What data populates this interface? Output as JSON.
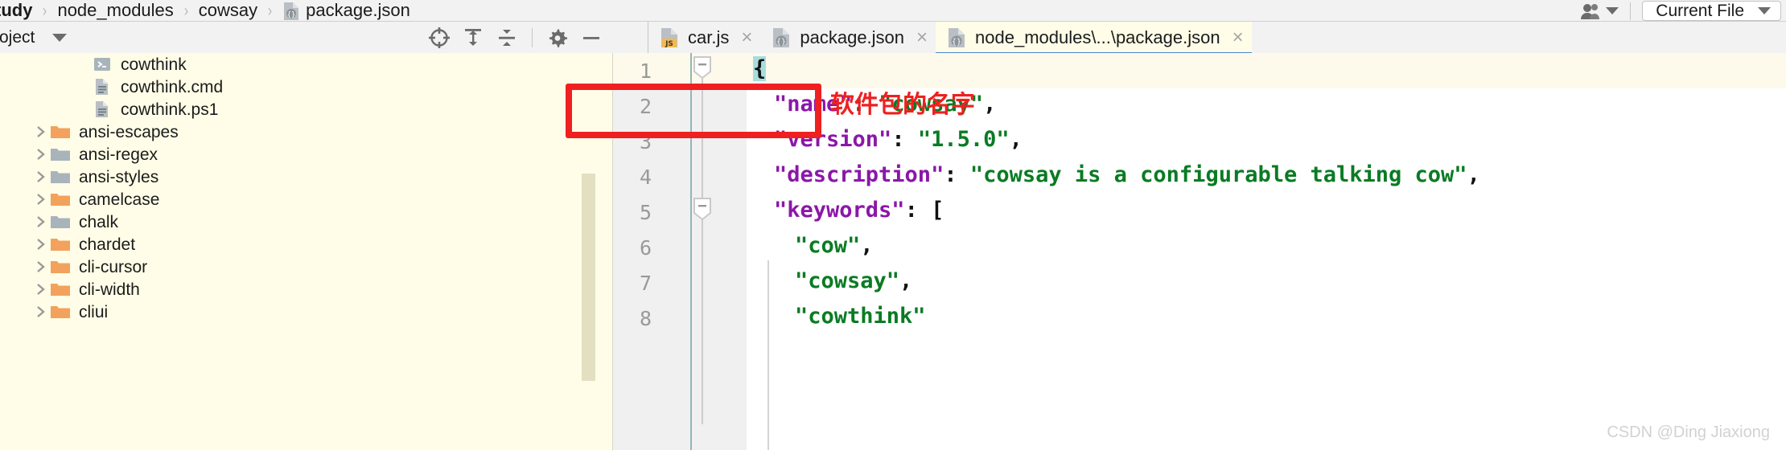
{
  "breadcrumb": {
    "items": [
      {
        "label": "tudy",
        "icon": null
      },
      {
        "label": "node_modules",
        "icon": null
      },
      {
        "label": "cowsay",
        "icon": null
      },
      {
        "label": "package.json",
        "icon": "json-file-icon"
      }
    ],
    "separator": "›"
  },
  "topbar_right": {
    "people_icon": "people-icon",
    "scope_label": "Current File",
    "scope_caret": "caret-down-icon"
  },
  "project_toolbar": {
    "title": "roject",
    "caret": "caret-down-icon",
    "icons": [
      {
        "name": "locate-target-icon",
        "title": "Select Opened File"
      },
      {
        "name": "expand-all-icon",
        "title": "Expand All"
      },
      {
        "name": "collapse-all-icon",
        "title": "Collapse All"
      },
      {
        "name": "gear-icon",
        "title": "Settings"
      },
      {
        "name": "hide-minus-icon",
        "title": "Hide"
      }
    ]
  },
  "tabs": [
    {
      "label": "car.js",
      "icon": "js-file-icon",
      "active": false,
      "close": "×"
    },
    {
      "label": "package.json",
      "icon": "json-file-icon",
      "active": false,
      "close": "×"
    },
    {
      "label": "node_modules\\...\\package.json",
      "icon": "json-file-icon",
      "active": true,
      "close": "×"
    }
  ],
  "sidebar": {
    "items": [
      {
        "label": "cowthink",
        "icon": "script-file-icon",
        "arrow": "",
        "indent": 3,
        "folder_color": null
      },
      {
        "label": "cowthink.cmd",
        "icon": "text-file-icon",
        "arrow": "",
        "indent": 3,
        "folder_color": null
      },
      {
        "label": "cowthink.ps1",
        "icon": "text-file-icon",
        "arrow": "",
        "indent": 3,
        "folder_color": null
      },
      {
        "label": "ansi-escapes",
        "icon": "folder-icon",
        "arrow": "›",
        "indent": 1,
        "folder_color": "#f2a25c"
      },
      {
        "label": "ansi-regex",
        "icon": "folder-icon",
        "arrow": "›",
        "indent": 1,
        "folder_color": "#a9b3bb"
      },
      {
        "label": "ansi-styles",
        "icon": "folder-icon",
        "arrow": "›",
        "indent": 1,
        "folder_color": "#a9b3bb"
      },
      {
        "label": "camelcase",
        "icon": "folder-icon",
        "arrow": "›",
        "indent": 1,
        "folder_color": "#f2a25c"
      },
      {
        "label": "chalk",
        "icon": "folder-icon",
        "arrow": "›",
        "indent": 1,
        "folder_color": "#a9b3bb"
      },
      {
        "label": "chardet",
        "icon": "folder-icon",
        "arrow": "›",
        "indent": 1,
        "folder_color": "#f2a25c"
      },
      {
        "label": "cli-cursor",
        "icon": "folder-icon",
        "arrow": "›",
        "indent": 1,
        "folder_color": "#f2a25c"
      },
      {
        "label": "cli-width",
        "icon": "folder-icon",
        "arrow": "›",
        "indent": 1,
        "folder_color": "#f2a25c"
      },
      {
        "label": "cliui",
        "icon": "folder-icon",
        "arrow": "›",
        "indent": 1,
        "folder_color": "#f2a25c"
      }
    ],
    "scrollbar": "vertical-scrollbar"
  },
  "editor": {
    "line_numbers": [
      "1",
      "2",
      "3",
      "4",
      "5",
      "6",
      "7",
      "8"
    ],
    "fold_markers": [
      {
        "line": 1,
        "state": "expanded"
      },
      {
        "line": 5,
        "state": "expanded"
      }
    ],
    "lines": [
      {
        "n": 1,
        "indent": 0,
        "tokens": [
          {
            "t": "{",
            "c": "p brace-hl"
          }
        ]
      },
      {
        "n": 2,
        "indent": 1,
        "tokens": [
          {
            "t": "\"name\"",
            "c": "k"
          },
          {
            "t": ": ",
            "c": "p"
          },
          {
            "t": "\"cowsay\"",
            "c": "s"
          },
          {
            "t": ",",
            "c": "p"
          }
        ]
      },
      {
        "n": 3,
        "indent": 1,
        "tokens": [
          {
            "t": "\"version\"",
            "c": "k"
          },
          {
            "t": ": ",
            "c": "p"
          },
          {
            "t": "\"1.5.0\"",
            "c": "s"
          },
          {
            "t": ",",
            "c": "p"
          }
        ]
      },
      {
        "n": 4,
        "indent": 1,
        "tokens": [
          {
            "t": "\"description\"",
            "c": "k"
          },
          {
            "t": ": ",
            "c": "p"
          },
          {
            "t": "\"cowsay is a configurable talking cow\"",
            "c": "s"
          },
          {
            "t": ",",
            "c": "p"
          }
        ]
      },
      {
        "n": 5,
        "indent": 1,
        "tokens": [
          {
            "t": "\"keywords\"",
            "c": "k"
          },
          {
            "t": ": ",
            "c": "p"
          },
          {
            "t": "[",
            "c": "p"
          }
        ]
      },
      {
        "n": 6,
        "indent": 2,
        "tokens": [
          {
            "t": "\"cow\"",
            "c": "s"
          },
          {
            "t": ",",
            "c": "p"
          }
        ]
      },
      {
        "n": 7,
        "indent": 2,
        "tokens": [
          {
            "t": "\"cowsay\"",
            "c": "s"
          },
          {
            "t": ",",
            "c": "p"
          }
        ]
      },
      {
        "n": 8,
        "indent": 2,
        "tokens": [
          {
            "t": "\"cowthink\"",
            "c": "s"
          }
        ]
      }
    ]
  },
  "annotations": {
    "highlight_box": {
      "name": "name-field-highlight",
      "color": "#ef2020"
    },
    "note_text": "软件包的名字",
    "note_color": "#ef2020"
  },
  "watermark": "CSDN @Ding Jiaxiong",
  "colors": {
    "sidebar_bg": "#fffde7",
    "active_tab_bg": "#fffde7",
    "active_tab_underline": "#4a86c8",
    "json_key": "#8b17a8",
    "json_string": "#0a7b23",
    "brace_highlight": "#a8dcdc",
    "folder_orange": "#f2a25c",
    "folder_gray": "#a9b3bb"
  }
}
